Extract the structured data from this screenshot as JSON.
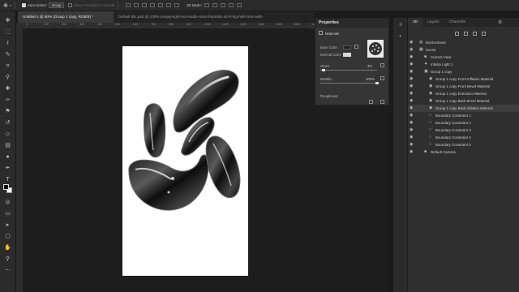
{
  "options_bar": {
    "auto_select_label": "Auto-Select:",
    "auto_select_value": "Group",
    "show_transform_label": "Show Transform Controls",
    "mode_label": "3D Mode:"
  },
  "tabs": [
    {
      "label": "Untitled-1 @ 50% (Group 1 copy, RGB/8) *"
    },
    {
      "label": "Default IBL.psb @ 100% (empty-light-red-studio-room-futuristic-sci-fi-big-hall-room-with-"
    }
  ],
  "ruler_h": [
    "0",
    "100",
    "200",
    "300",
    "400",
    "500",
    "600",
    "700",
    "800",
    "900",
    "1000",
    "1100",
    "1200",
    "1300",
    "1400",
    "1500",
    "1600"
  ],
  "properties": {
    "title": "Properties",
    "section": "Materials",
    "base_color_label": "Base Color:",
    "internal_color_label": "Internal Color:",
    "gloss_label": "Gloss:",
    "gloss_value": "3%",
    "metallic_label": "Metallic:",
    "metallic_value": "100%",
    "roughness_label": "Roughness:"
  },
  "panel3d": {
    "tabs": [
      "3D",
      "Layers",
      "Channels"
    ],
    "items": [
      {
        "label": "Environment",
        "indent": 0,
        "icon": "globe-icon",
        "selected": false
      },
      {
        "label": "Scene",
        "indent": 0,
        "icon": "scene-icon",
        "selected": false
      },
      {
        "label": "Current View",
        "indent": 1,
        "icon": "camera-icon",
        "selected": false
      },
      {
        "label": "Infinite Light 1",
        "indent": 1,
        "icon": "light-icon",
        "selected": false
      },
      {
        "label": "Group 1 copy",
        "indent": 1,
        "icon": "folder-icon",
        "selected": false
      },
      {
        "label": "Group 1 copy Front Inflation Material",
        "indent": 2,
        "icon": "material-icon",
        "selected": false
      },
      {
        "label": "Group 1 copy Front Bevel Material",
        "indent": 2,
        "icon": "material-icon",
        "selected": false
      },
      {
        "label": "Group 1 copy Extrusion Material",
        "indent": 2,
        "icon": "material-icon",
        "selected": false
      },
      {
        "label": "Group 1 copy Back Bevel Material",
        "indent": 2,
        "icon": "material-icon",
        "selected": false
      },
      {
        "label": "Group 1 copy Back Inflation Material",
        "indent": 2,
        "icon": "material-icon",
        "selected": true
      },
      {
        "label": "Boundary Constraint 1",
        "indent": 2,
        "icon": "constraint-icon",
        "selected": false
      },
      {
        "label": "Boundary Constraint 2",
        "indent": 2,
        "icon": "constraint-icon",
        "selected": false
      },
      {
        "label": "Boundary Constraint 3",
        "indent": 2,
        "icon": "constraint-icon",
        "selected": false
      },
      {
        "label": "Boundary Constraint 4",
        "indent": 2,
        "icon": "constraint-icon",
        "selected": false
      },
      {
        "label": "Boundary Constraint 5",
        "indent": 2,
        "icon": "constraint-icon",
        "selected": false
      },
      {
        "label": "Default Camera",
        "indent": 1,
        "icon": "camera-icon",
        "selected": false
      }
    ]
  },
  "colors": {
    "base_color": "#222222",
    "internal_color": "#d8d8d8",
    "accent": "#3d3d3d"
  }
}
